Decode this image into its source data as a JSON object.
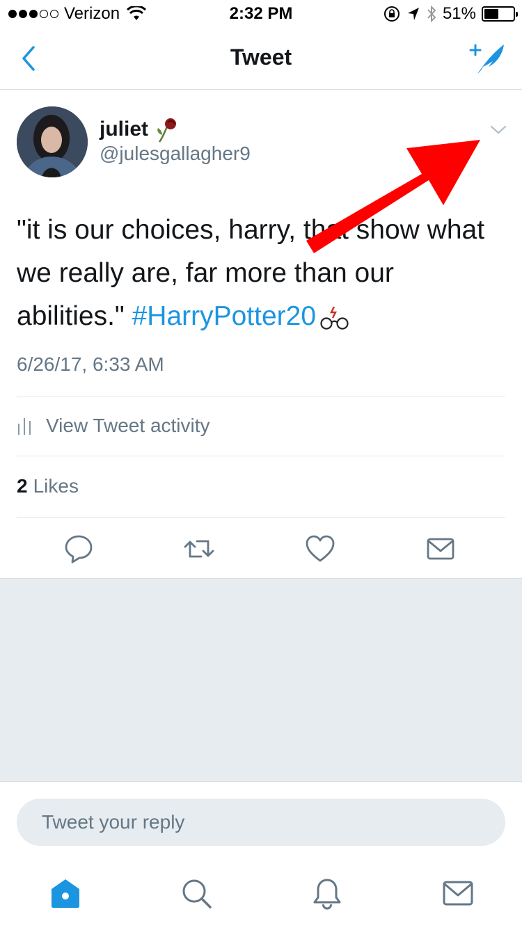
{
  "status_bar": {
    "carrier": "Verizon",
    "time": "2:32 PM",
    "battery": "51%",
    "battery_level": 0.51
  },
  "nav": {
    "title": "Tweet",
    "back_icon": "chevron-left-icon",
    "compose_icon": "compose-tweet-icon"
  },
  "tweet": {
    "author_name": "juliet",
    "author_handle": "@julesgallagher9",
    "text_before": "\"it is our choices, harry, that show what we really are, far more than our abilities.\" ",
    "hashtag": "#HarryPotter20",
    "timestamp": "6/26/17, 6:33 AM",
    "activity_label": "View Tweet activity",
    "likes_count": "2",
    "likes_label": "Likes"
  },
  "reply": {
    "placeholder": "Tweet your reply"
  },
  "colors": {
    "accent": "#1b95e0",
    "annotation_arrow": "#ff0000"
  }
}
